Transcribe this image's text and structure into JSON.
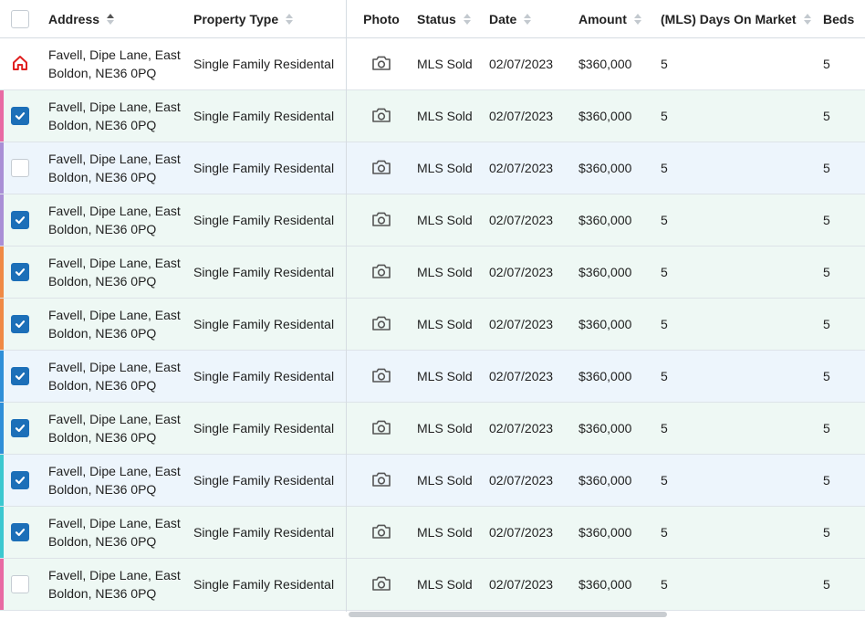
{
  "columns": {
    "address": "Address",
    "property_type": "Property Type",
    "photo": "Photo",
    "status": "Status",
    "date": "Date",
    "amount": "Amount",
    "days_on_market": "(MLS) Days On Market",
    "beds": "Beds"
  },
  "colors": {
    "checkbox_checked": "#1c6fb8",
    "home_icon": "#e02020",
    "band_green": "#eef8f4",
    "band_blue": "#edf5fc"
  },
  "rows": [
    {
      "address": "Favell, Dipe Lane, East Boldon, NE36 0PQ",
      "property_type": "Single Family Residental",
      "status": "MLS Sold",
      "date": "02/07/2023",
      "amount": "$360,000",
      "days_on_market": "5",
      "beds": "5",
      "selector": "home-icon",
      "checked": false,
      "bar_color": "",
      "band": "white"
    },
    {
      "address": "Favell, Dipe Lane, East Boldon, NE36 0PQ",
      "property_type": "Single Family Residental",
      "status": "MLS Sold",
      "date": "02/07/2023",
      "amount": "$360,000",
      "days_on_market": "5",
      "beds": "5",
      "selector": "checkbox",
      "checked": true,
      "bar_color": "#e86aa3",
      "band": "green"
    },
    {
      "address": "Favell, Dipe Lane, East Boldon, NE36 0PQ",
      "property_type": "Single Family Residental",
      "status": "MLS Sold",
      "date": "02/07/2023",
      "amount": "$360,000",
      "days_on_market": "5",
      "beds": "5",
      "selector": "checkbox",
      "checked": false,
      "bar_color": "#a98fd6",
      "band": "blue"
    },
    {
      "address": "Favell, Dipe Lane, East Boldon, NE36 0PQ",
      "property_type": "Single Family Residental",
      "status": "MLS Sold",
      "date": "02/07/2023",
      "amount": "$360,000",
      "days_on_market": "5",
      "beds": "5",
      "selector": "checkbox",
      "checked": true,
      "bar_color": "#a98fd6",
      "band": "green"
    },
    {
      "address": "Favell, Dipe Lane, East Boldon, NE36 0PQ",
      "property_type": "Single Family Residental",
      "status": "MLS Sold",
      "date": "02/07/2023",
      "amount": "$360,000",
      "days_on_market": "5",
      "beds": "5",
      "selector": "checkbox",
      "checked": true,
      "bar_color": "#f08a45",
      "band": "green"
    },
    {
      "address": "Favell, Dipe Lane, East Boldon, NE36 0PQ",
      "property_type": "Single Family Residental",
      "status": "MLS Sold",
      "date": "02/07/2023",
      "amount": "$360,000",
      "days_on_market": "5",
      "beds": "5",
      "selector": "checkbox",
      "checked": true,
      "bar_color": "#f08a45",
      "band": "green"
    },
    {
      "address": "Favell, Dipe Lane, East Boldon, NE36 0PQ",
      "property_type": "Single Family Residental",
      "status": "MLS Sold",
      "date": "02/07/2023",
      "amount": "$360,000",
      "days_on_market": "5",
      "beds": "5",
      "selector": "checkbox",
      "checked": true,
      "bar_color": "#2f8fd8",
      "band": "blue"
    },
    {
      "address": "Favell, Dipe Lane, East Boldon, NE36 0PQ",
      "property_type": "Single Family Residental",
      "status": "MLS Sold",
      "date": "02/07/2023",
      "amount": "$360,000",
      "days_on_market": "5",
      "beds": "5",
      "selector": "checkbox",
      "checked": true,
      "bar_color": "#2f8fd8",
      "band": "green"
    },
    {
      "address": "Favell, Dipe Lane, East Boldon, NE36 0PQ",
      "property_type": "Single Family Residental",
      "status": "MLS Sold",
      "date": "02/07/2023",
      "amount": "$360,000",
      "days_on_market": "5",
      "beds": "5",
      "selector": "checkbox",
      "checked": true,
      "bar_color": "#3cc8d0",
      "band": "blue"
    },
    {
      "address": "Favell, Dipe Lane, East Boldon, NE36 0PQ",
      "property_type": "Single Family Residental",
      "status": "MLS Sold",
      "date": "02/07/2023",
      "amount": "$360,000",
      "days_on_market": "5",
      "beds": "5",
      "selector": "checkbox",
      "checked": true,
      "bar_color": "#3cc8d0",
      "band": "green"
    },
    {
      "address": "Favell, Dipe Lane, East Boldon, NE36 0PQ",
      "property_type": "Single Family Residental",
      "status": "MLS Sold",
      "date": "02/07/2023",
      "amount": "$360,000",
      "days_on_market": "5",
      "beds": "5",
      "selector": "checkbox",
      "checked": false,
      "bar_color": "#e86aa3",
      "band": "green"
    }
  ]
}
